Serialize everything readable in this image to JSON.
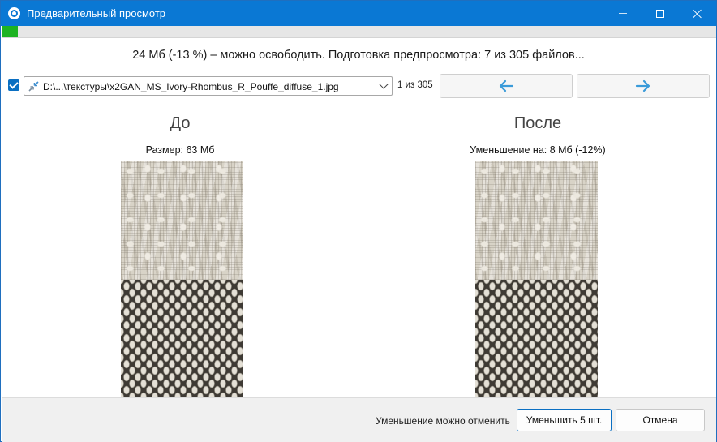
{
  "window": {
    "title": "Предварительный просмотр"
  },
  "progress": {
    "fraction": 0.023,
    "color": "#1db322"
  },
  "summary": {
    "text": "24 Мб (-13 %) – можно освободить. Подготовка предпросмотра: 7 из 305 файлов..."
  },
  "file": {
    "checked": true,
    "path": "D:\\...\\текстуры\\x2GAN_MS_Ivory-Rhombus_R_Pouffe_diffuse_1.jpg",
    "counter": "1 из 305"
  },
  "before": {
    "heading": "До",
    "info": "Размер: 63 Мб"
  },
  "after": {
    "heading": "После",
    "info": "Уменьшение на: 8 Мб (-12%)"
  },
  "footer": {
    "undo_note": "Уменьшение можно отменить",
    "apply_label": "Уменьшить 5 шт.",
    "cancel_label": "Отмена"
  },
  "colors": {
    "accent": "#0a78d4",
    "arrow": "#3a9bd9"
  },
  "icons": {
    "app": "app-logo-icon",
    "prev": "arrow-left-icon",
    "next": "arrow-right-icon",
    "file": "compress-arrows-icon",
    "dropdown": "chevron-down-icon"
  }
}
